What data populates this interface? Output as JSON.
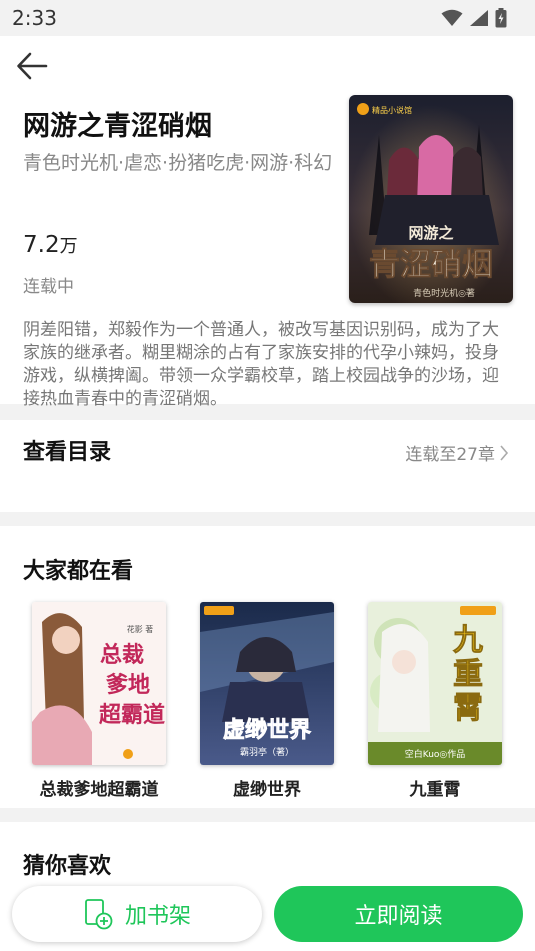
{
  "status_bar": {
    "time": "2:33"
  },
  "book": {
    "title": "网游之青涩硝烟",
    "tags": "青色时光机·虐恋·扮猪吃虎·网游·科幻",
    "word_count": "7.2",
    "word_unit": "万",
    "status": "连载中",
    "cover": {
      "publisher_mark": "精品小说馆",
      "title_small": "网游之",
      "title_large": "青涩硝烟",
      "author_line": "青色时光机◎著"
    },
    "description": "阴差阳错，郑毅作为一个普通人，被改写基因识别码，成为了大家族的继承者。糊里糊涂的占有了家族安排的代孕小辣妈，投身游戏，纵横捭阖。带领一众学霸校草，踏上校园战争的沙场，迎接热血青春中的青涩硝烟。"
  },
  "toc": {
    "title": "查看目录",
    "status": "连载至27章"
  },
  "popular": {
    "title": "大家都在看",
    "books": [
      {
        "name": "总裁爹地超霸道",
        "cover_title": "总裁爹地超霸道",
        "cover_author": "花影 著"
      },
      {
        "name": "虚缈世界",
        "cover_title": "虚缈世界",
        "cover_author": "霸羽亭（著）"
      },
      {
        "name": "九重霄",
        "cover_title": "九重霄",
        "cover_author": "空白Kuo◎作品"
      }
    ]
  },
  "guess": {
    "title": "猜你喜欢"
  },
  "actions": {
    "add_shelf": "加书架",
    "read_now": "立即阅读"
  },
  "colors": {
    "accent": "#1fc65a",
    "muted": "#888888",
    "bg": "#f2f2f2"
  }
}
